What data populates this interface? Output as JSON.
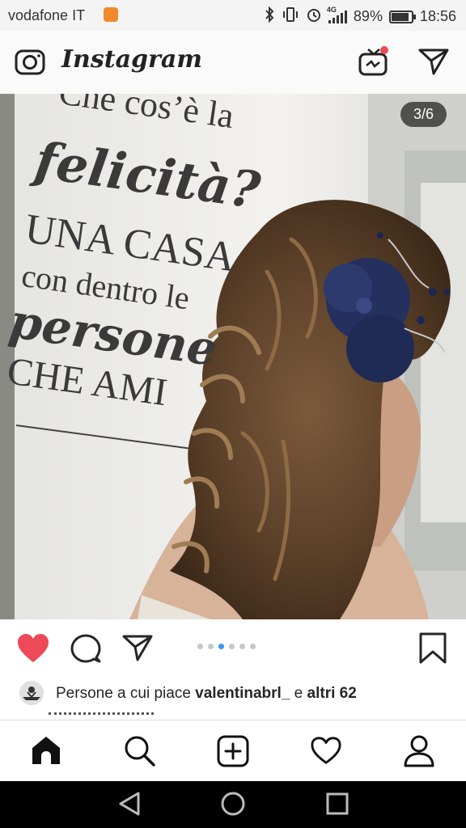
{
  "status_bar": {
    "carrier": "vodafone IT",
    "network": "4G",
    "battery": "89%",
    "battery_level": 0.89,
    "time": "18:56"
  },
  "header": {
    "app_name": "Instagram"
  },
  "post": {
    "carousel_counter": "3/6",
    "carousel_index": 3,
    "carousel_total": 6,
    "photo_text": {
      "line1": "Che cos’è la",
      "line2": "felicità?",
      "line3": "UNA CASA",
      "line4": "con dentro le",
      "line5": "persone",
      "line6": "CHE AMI"
    },
    "likes_prefix": "Persone a cui piace",
    "liked_by_user": "valentinabrl_",
    "likes_middle": "e",
    "likes_others": "altri 62"
  },
  "colors": {
    "like_red": "#ed4956",
    "active_dot": "#3897f0",
    "inactive_dot": "#c7c7c7",
    "text": "#262626"
  },
  "icons": {
    "camera": "camera-icon",
    "igtv": "igtv-icon",
    "direct": "direct-message-icon",
    "like": "heart-filled-icon",
    "comment": "comment-icon",
    "share": "share-icon",
    "save": "bookmark-icon",
    "home": "home-icon",
    "search": "search-icon",
    "add": "add-post-icon",
    "activity": "heart-outline-icon",
    "profile": "profile-icon",
    "back": "back-triangle-icon",
    "home_nav": "home-circle-icon",
    "recents": "recents-square-icon"
  }
}
